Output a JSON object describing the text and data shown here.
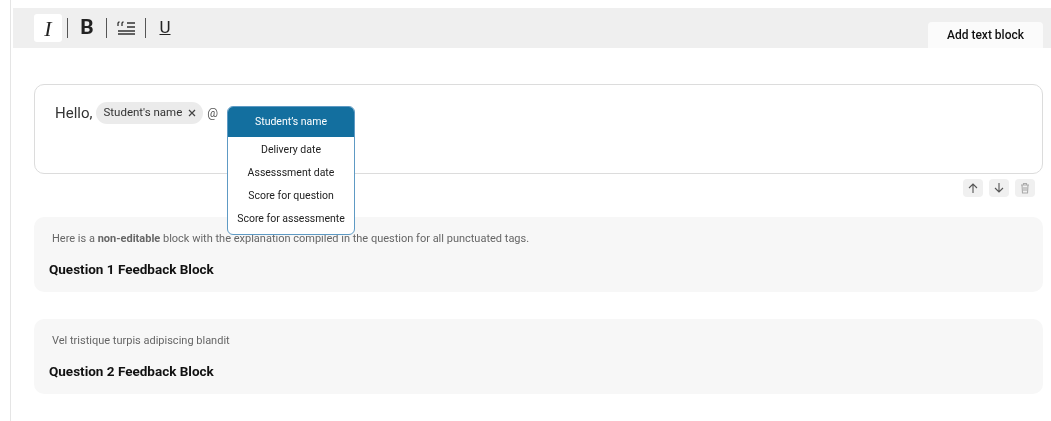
{
  "toolbar": {
    "tools": [
      {
        "kind": "italic",
        "label": "I",
        "selected": true
      },
      {
        "kind": "bold",
        "label": "B",
        "selected": false
      },
      {
        "kind": "quote",
        "selected": false
      },
      {
        "kind": "underline",
        "label": "U",
        "selected": false
      }
    ],
    "add_button": "Add text block"
  },
  "editor": {
    "greeting": "Hello,",
    "tag": {
      "label": "Student's name"
    },
    "trigger": "@",
    "dropdown": [
      {
        "label": "Student’s name",
        "selected": true
      },
      {
        "label": "Delivery date",
        "selected": false
      },
      {
        "label": "Assesssment date",
        "selected": false
      },
      {
        "label": "Score for question",
        "selected": false
      },
      {
        "label": "Score for assessmente",
        "selected": false
      }
    ]
  },
  "block_actions": [
    {
      "kind": "up"
    },
    {
      "kind": "down"
    },
    {
      "kind": "delete"
    }
  ],
  "feedback_blocks": [
    {
      "description": "Here is a **non-editable** block with the explanation compiled in the question for all punctuated tags.",
      "title": "Question 1 Feedback Block"
    },
    {
      "description": "Vel tristique turpis adipiscing blandit",
      "title": "Question 2 Feedback Block"
    }
  ]
}
